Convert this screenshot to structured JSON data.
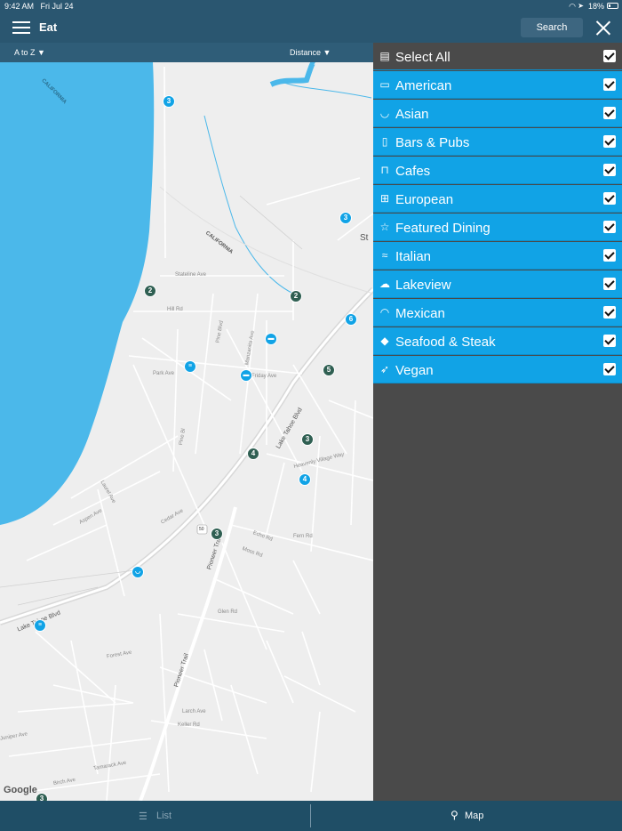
{
  "status": {
    "time": "9:42 AM",
    "date": "Fri Jul 24",
    "battery": "18%",
    "wifi_icon": "wifi-icon",
    "location_icon": "location-icon"
  },
  "header": {
    "title": "Eat",
    "search_label": "Search"
  },
  "sort": {
    "az_label": "A to Z ▼",
    "distance_label": "Distance ▼"
  },
  "map": {
    "region_labels": [
      "CALIFORNIA",
      "CALIFORNIA",
      "St"
    ],
    "street_labels": [
      "Stateline Ave",
      "Lake Tahoe Blvd",
      "Lake Tahoe Blvd",
      "Pioneer Trail",
      "Pioneer Trail",
      "Heavenly Village Way",
      "Hill Rd",
      "Park Ave",
      "Friday Ave",
      "Cedar Ave",
      "Pine Blvd",
      "Larch Ave",
      "Keller Rd",
      "Glen Rd",
      "Fern Rd",
      "Echo Rd",
      "Moss Rd",
      "Manzanita Ave",
      "Laurel Ave",
      "Pine Bl",
      "Aspen Ave",
      "Forest Ave",
      "Tamarack Ave",
      "Birch Ave",
      "Juniper Ave"
    ],
    "clusters": [
      {
        "kind": "blue",
        "count": "3"
      },
      {
        "kind": "blue",
        "count": "3"
      },
      {
        "kind": "dark",
        "count": "2"
      },
      {
        "kind": "dark",
        "count": "2"
      },
      {
        "kind": "blue",
        "count": "6"
      },
      {
        "kind": "dark",
        "count": "5"
      },
      {
        "kind": "dark",
        "count": "3"
      },
      {
        "kind": "dark",
        "count": "4"
      },
      {
        "kind": "blue",
        "count": "4"
      },
      {
        "kind": "dark",
        "count": "3"
      },
      {
        "kind": "dark",
        "count": "3"
      }
    ],
    "attribution": "Google",
    "highway_shield": "50"
  },
  "filters": {
    "select_all": {
      "label": "Select All",
      "icon": "checklist-icon",
      "checked": true
    },
    "items": [
      {
        "label": "American",
        "icon": "burger-icon",
        "checked": true
      },
      {
        "label": "Asian",
        "icon": "bowl-icon",
        "checked": true
      },
      {
        "label": "Bars & Pubs",
        "icon": "beer-icon",
        "checked": true
      },
      {
        "label": "Cafes",
        "icon": "cafe-icon",
        "checked": true
      },
      {
        "label": "European",
        "icon": "european-icon",
        "checked": true
      },
      {
        "label": "Featured Dining",
        "icon": "star-icon",
        "checked": true
      },
      {
        "label": "Italian",
        "icon": "pasta-icon",
        "checked": true
      },
      {
        "label": "Lakeview",
        "icon": "lakeview-icon",
        "checked": true
      },
      {
        "label": "Mexican",
        "icon": "taco-icon",
        "checked": true
      },
      {
        "label": "Seafood & Steak",
        "icon": "fish-icon",
        "checked": true
      },
      {
        "label": "Vegan",
        "icon": "carrot-icon",
        "checked": true
      }
    ]
  },
  "tabs": {
    "list_label": "List",
    "map_label": "Map"
  },
  "colors": {
    "header": "#2a5670",
    "accent": "#11a3e6",
    "lake": "#4bb8ea",
    "panel": "#4a4a4a",
    "cluster_dark": "#2f5f52"
  }
}
